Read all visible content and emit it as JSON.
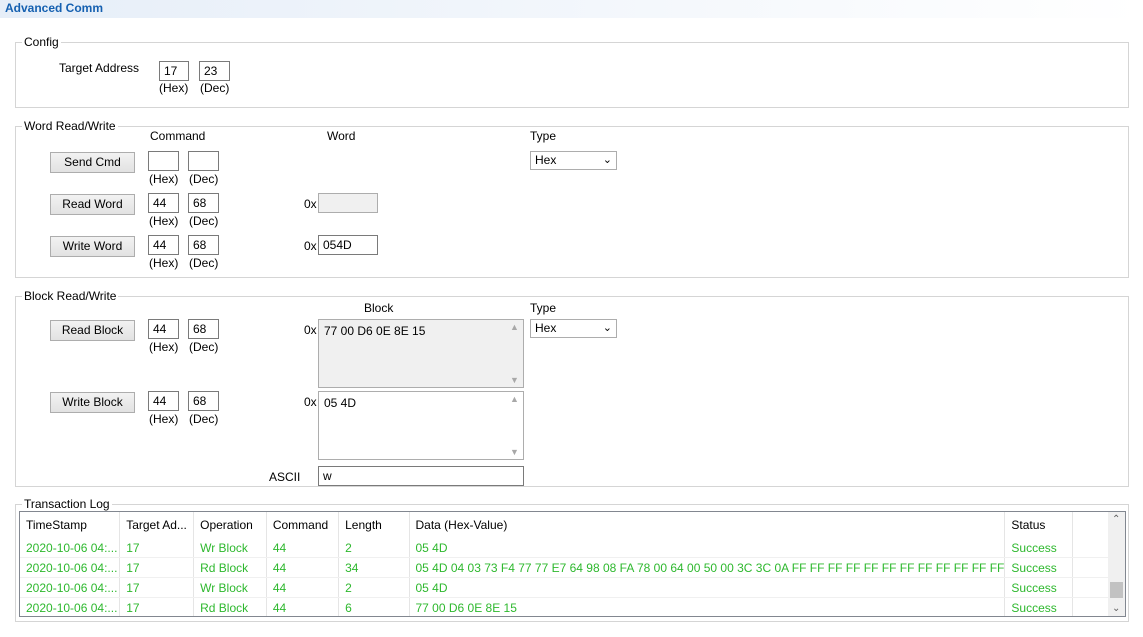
{
  "window": {
    "title": "Advanced Comm"
  },
  "config": {
    "legend": "Config",
    "target_label": "Target Address",
    "target_hex": "17",
    "target_dec": "23",
    "hex_unit": "(Hex)",
    "dec_unit": "(Dec)"
  },
  "word": {
    "legend": "Word Read/Write",
    "command_header": "Command",
    "word_header": "Word",
    "type_header": "Type",
    "type_value": "Hex",
    "prefix": "0x",
    "hex_unit": "(Hex)",
    "dec_unit": "(Dec)",
    "send": {
      "label": "Send Cmd",
      "hex": "",
      "dec": ""
    },
    "read": {
      "label": "Read Word",
      "hex": "44",
      "dec": "68",
      "value": ""
    },
    "write": {
      "label": "Write Word",
      "hex": "44",
      "dec": "68",
      "value": "054D"
    }
  },
  "block": {
    "legend": "Block Read/Write",
    "block_header": "Block",
    "type_header": "Type",
    "type_value": "Hex",
    "prefix": "0x",
    "hex_unit": "(Hex)",
    "dec_unit": "(Dec)",
    "read": {
      "label": "Read Block",
      "hex": "44",
      "dec": "68",
      "value": "77 00 D6 0E 8E 15"
    },
    "write": {
      "label": "Write Block",
      "hex": "44",
      "dec": "68",
      "value": "05 4D"
    },
    "ascii_label": "ASCII",
    "ascii_value": "w"
  },
  "log": {
    "legend": "Transaction Log",
    "columns": [
      "TimeStamp",
      "Target Ad...",
      "Operation",
      "Command",
      "Length",
      "Data (Hex-Value)",
      "Status"
    ],
    "rows": [
      [
        "2020-10-06 04:...",
        "17",
        "Wr Block",
        "44",
        "2",
        "05 4D",
        "Success"
      ],
      [
        "2020-10-06 04:...",
        "17",
        "Rd Block",
        "44",
        "34",
        "05 4D 04 03 73 F4 77 77 E7 64 98 08 FA 78 00 64 00 50 00 3C 3C 0A FF FF FF FF FF FF FF FF FF FF FF FF",
        "Success"
      ],
      [
        "2020-10-06 04:...",
        "17",
        "Wr Block",
        "44",
        "2",
        "05 4D",
        "Success"
      ],
      [
        "2020-10-06 04:...",
        "17",
        "Rd Block",
        "44",
        "6",
        "77 00 D6 0E 8E 15",
        "Success"
      ]
    ],
    "row_color": "#2eb82e"
  }
}
